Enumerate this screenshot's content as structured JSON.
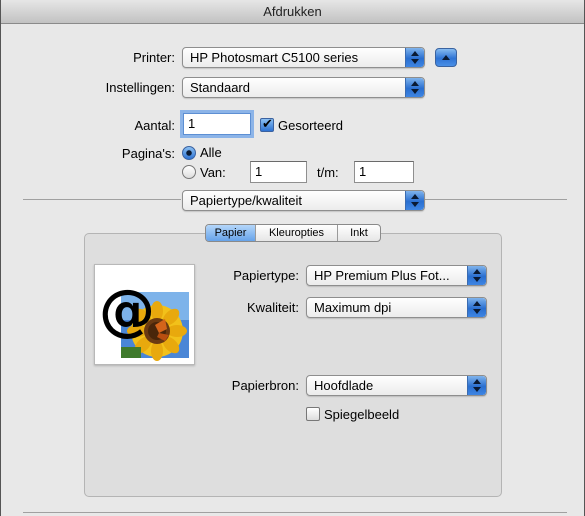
{
  "window": {
    "title": "Afdrukken"
  },
  "printer": {
    "label": "Printer:",
    "value": "HP Photosmart C5100 series"
  },
  "presets": {
    "label": "Instellingen:",
    "value": "Standaard"
  },
  "copies": {
    "label": "Aantal:",
    "value": "1",
    "collated_label": "Gesorteerd",
    "collated": true
  },
  "pages": {
    "label": "Pagina's:",
    "all_label": "Alle",
    "from_label": "Van:",
    "from_value": "1",
    "to_label": "t/m:",
    "to_value": "1",
    "selected": "all"
  },
  "section": {
    "value": "Papiertype/kwaliteit"
  },
  "tabs": [
    {
      "label": "Papier",
      "active": true
    },
    {
      "label": "Kleuropties",
      "active": false
    },
    {
      "label": "Inkt",
      "active": false
    }
  ],
  "paper": {
    "type_label": "Papiertype:",
    "type_value": "HP Premium Plus Fot...",
    "quality_label": "Kwaliteit:",
    "quality_value": "Maximum dpi",
    "source_label": "Papierbron:",
    "source_value": "Hoofdlade",
    "mirror_label": "Spiegelbeeld",
    "mirror": false
  },
  "icons": {
    "preview": "sunflower-photo-preview-icon",
    "at_symbol": "@"
  },
  "colors": {
    "accent": "#2d72d2",
    "window_bg": "#e8e8e8"
  }
}
